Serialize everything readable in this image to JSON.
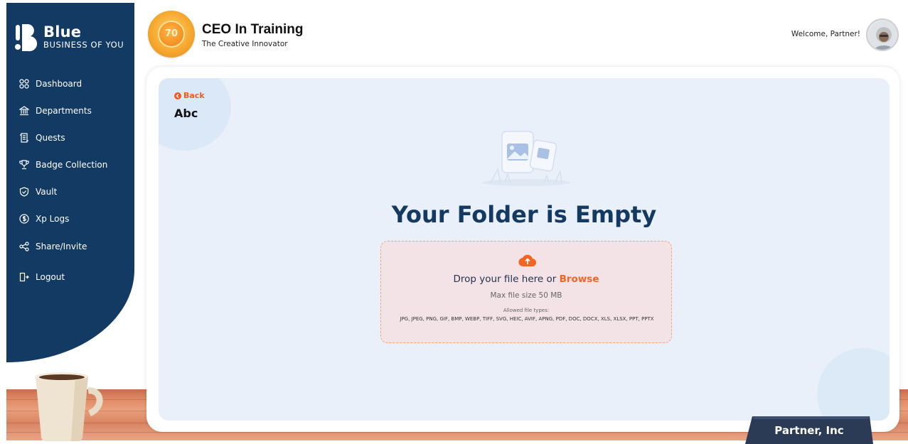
{
  "brand": {
    "title": "Blue",
    "subtitle": "BUSINESS OF YOU"
  },
  "sidebar": {
    "items": [
      {
        "label": "Dashboard",
        "icon": "grid-icon"
      },
      {
        "label": "Departments",
        "icon": "bank-icon"
      },
      {
        "label": "Quests",
        "icon": "scroll-icon"
      },
      {
        "label": "Badge Collection",
        "icon": "trophy-icon"
      },
      {
        "label": "Vault",
        "icon": "shield-icon"
      },
      {
        "label": "Xp Logs",
        "icon": "dollar-coin-icon"
      },
      {
        "label": "Share/Invite",
        "icon": "share-icon"
      },
      {
        "label": "Logout",
        "icon": "logout-icon"
      }
    ]
  },
  "header": {
    "level": "70",
    "rank_title": "CEO In Training",
    "rank_subtitle": "The Creative Innovator",
    "welcome": "Welcome, Partner!"
  },
  "folder": {
    "back_label": "Back",
    "name": "Abc",
    "empty_title": "Your Folder is Empty"
  },
  "upload": {
    "drop_text": "Drop your file here or",
    "browse_label": "Browse",
    "max_size": "Max file size 50 MB",
    "allowed_label": "Allowed file types:",
    "allowed_types": "JPG, JPEG, PNG, GIF, BMP, WEBP, TIFF, SVG, HEIC, AVIF, APNG, PDF, DOC, DOCX, XLS, XLSX, PPT, PPTX"
  },
  "nameplate": {
    "label": "Partner, Inc"
  },
  "colors": {
    "sidebar": "#133a62",
    "accent": "#f26522",
    "title": "#143a62",
    "panel": "#eaf0f9"
  }
}
